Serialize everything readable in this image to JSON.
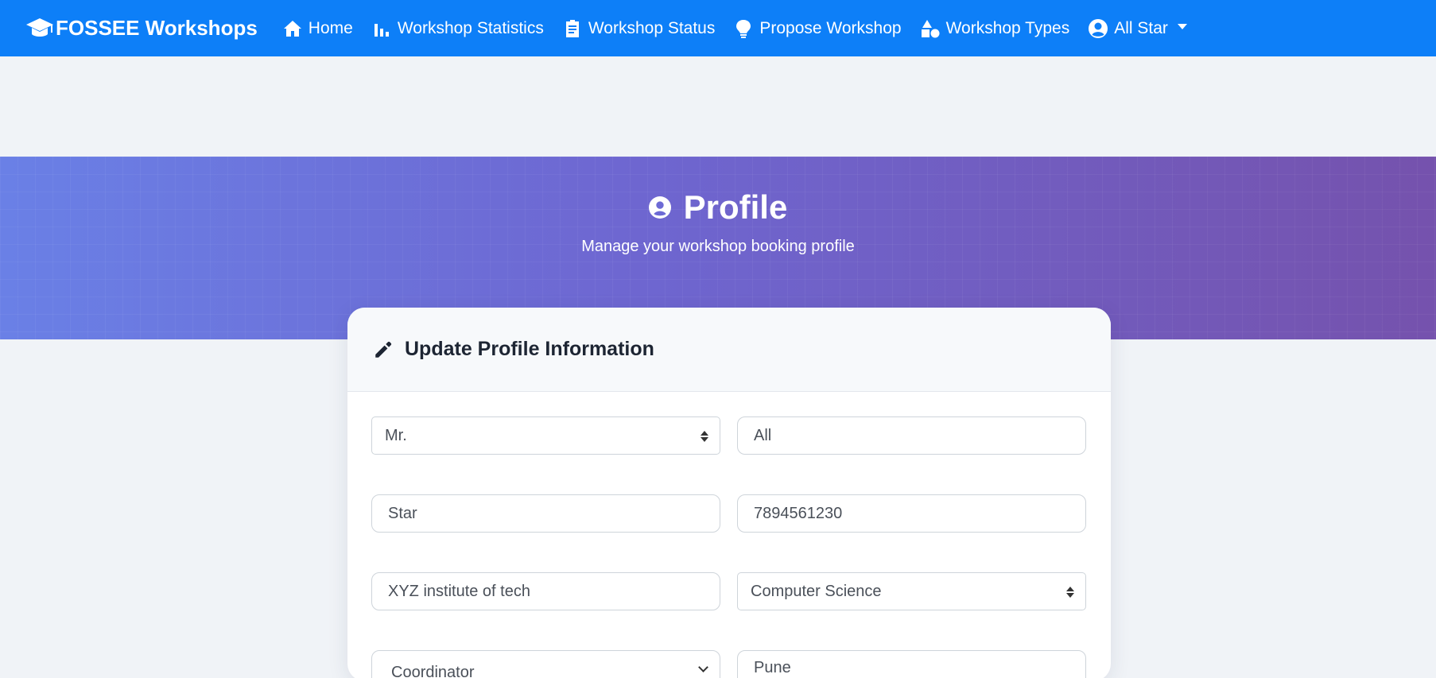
{
  "navbar": {
    "brand": "FOSSEE Workshops",
    "items": [
      {
        "label": "Home",
        "icon": "home-icon"
      },
      {
        "label": "Workshop Statistics",
        "icon": "bar-chart-icon"
      },
      {
        "label": "Workshop Status",
        "icon": "clipboard-icon"
      },
      {
        "label": "Propose Workshop",
        "icon": "lightbulb-icon"
      },
      {
        "label": "Workshop Types",
        "icon": "shapes-icon"
      },
      {
        "label": "All Star",
        "icon": "user-circle-icon"
      }
    ]
  },
  "hero": {
    "title": "Profile",
    "subtitle": "Manage your workshop booking profile"
  },
  "card": {
    "title": "Update Profile Information",
    "fields": {
      "title_select": "Mr.",
      "first_name": "All",
      "last_name": "Star",
      "phone": "7894561230",
      "institute": "XYZ institute of tech",
      "department": "Computer Science",
      "position": "Coordinator",
      "location": "Pune"
    }
  },
  "colors": {
    "navbar": "#0d7ff8",
    "hero_gradient_start": "#6a80e6",
    "hero_gradient_end": "#7552ad",
    "page_background": "#f0f3f7"
  }
}
